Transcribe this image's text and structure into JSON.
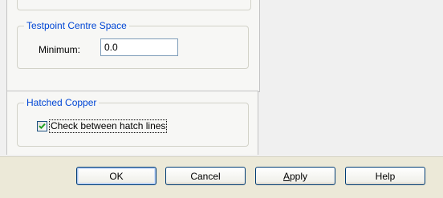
{
  "top_group": {
    "label": ""
  },
  "testpoint_group": {
    "label": "Testpoint Centre Space",
    "minimum_label": "Minimum:",
    "minimum_value": "0.0"
  },
  "hatched_group": {
    "label": "Hatched Copper",
    "checkbox_label": "Check between hatch lines",
    "checked": true
  },
  "buttons": {
    "ok": "OK",
    "cancel": "Cancel",
    "apply_mnemonic": "A",
    "apply_rest": "pply",
    "help": "Help"
  },
  "colors": {
    "group_label": "#0046d5",
    "button_border": "#003c74",
    "checkmark": "#21a121"
  }
}
